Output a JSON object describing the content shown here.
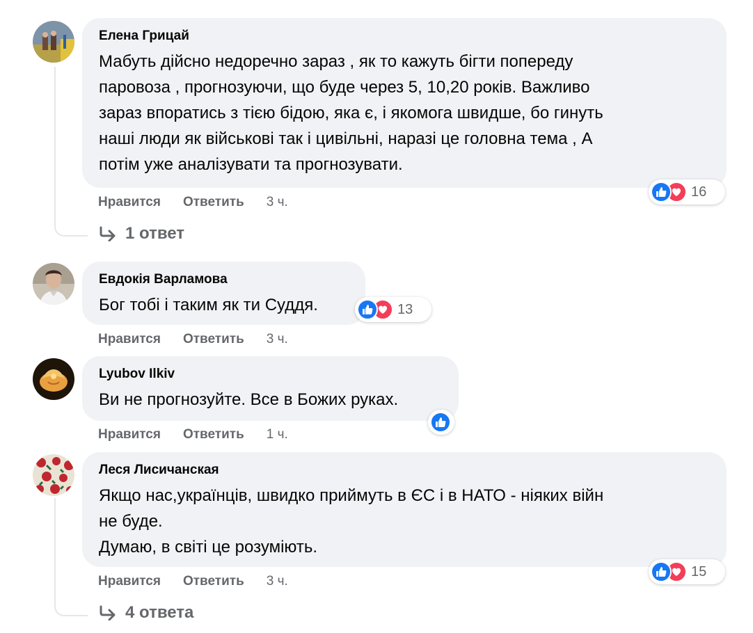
{
  "comments": [
    {
      "author": "Елена Грицай",
      "text": "Мабуть дійсно недоречно зараз , як то кажуть бігти попереду\nпаровоза , прогнозуючи, що буде через 5, 10,20 років. Важливо\nзараз впоратись з тією бідою, яка є, і якомога швидше, бо гинуть\nнаші люди як військові так і цивільні, наразі це головна тема , А\nпотім уже аналізувати та прогнозувати.",
      "like_label": "Нравится",
      "reply_label": "Ответить",
      "time": "3 ч.",
      "reactions": [
        "like-icon",
        "love-icon"
      ],
      "reaction_count": "16",
      "replies_label": "1 ответ"
    },
    {
      "author": "Евдокія Варламова",
      "text": "Бог тобі і таким як ти Суддя.",
      "like_label": "Нравится",
      "reply_label": "Ответить",
      "time": "3 ч.",
      "reactions": [
        "like-icon",
        "love-icon"
      ],
      "reaction_count": "13"
    },
    {
      "author": "Lyubov Ilkiv",
      "text": "Ви не прогнозуйте. Все в Божих руках.",
      "like_label": "Нравится",
      "reply_label": "Ответить",
      "time": "1 ч.",
      "reactions": [
        "like-icon"
      ]
    },
    {
      "author": "Леся Лисичанская",
      "text": "Якщо нас,українців, швидко приймуть в ЄС і в НАТО - ніяких війн\nне буде.\nДумаю, в світі це розуміють.",
      "like_label": "Нравится",
      "reply_label": "Ответить",
      "time": "3 ч.",
      "reactions": [
        "like-icon",
        "love-icon"
      ],
      "reaction_count": "15",
      "replies_label": "4 ответа"
    }
  ],
  "colors": {
    "bubble": "#f0f2f5",
    "meta": "#65676b",
    "like": "#1877f2",
    "love": "#f33e58"
  }
}
